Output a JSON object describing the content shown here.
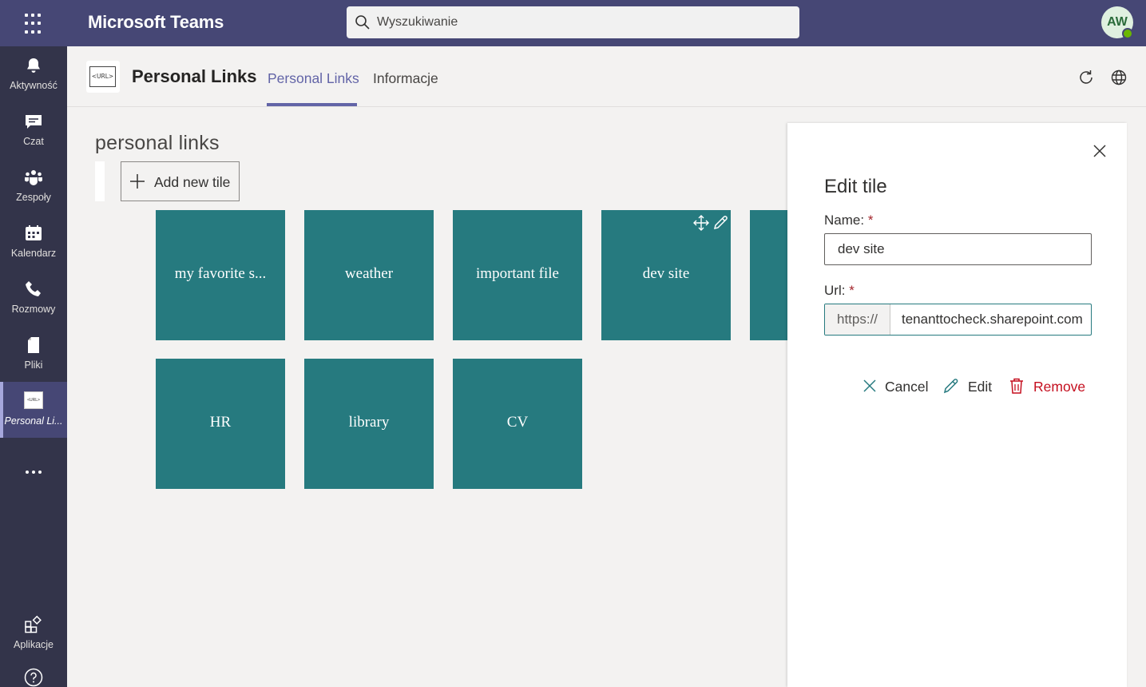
{
  "topbar": {
    "app_title": "Microsoft Teams",
    "search_placeholder": "Wyszukiwanie",
    "avatar_initials": "AW"
  },
  "rail": {
    "items": [
      {
        "label": "Aktywność",
        "icon": "bell-icon"
      },
      {
        "label": "Czat",
        "icon": "chat-icon"
      },
      {
        "label": "Zespoły",
        "icon": "teams-icon"
      },
      {
        "label": "Kalendarz",
        "icon": "calendar-icon"
      },
      {
        "label": "Rozmowy",
        "icon": "phone-icon"
      },
      {
        "label": "Pliki",
        "icon": "file-icon"
      },
      {
        "label": "Personal Li...",
        "icon": "personal-links-app-icon",
        "active": true
      }
    ],
    "apps_label": "Aplikacje"
  },
  "app_header": {
    "logo_text": "<URL>",
    "app_name": "Personal Links",
    "tabs": [
      {
        "label": "Personal Links",
        "active": true
      },
      {
        "label": "Informacje",
        "active": false
      }
    ]
  },
  "content": {
    "title": "personal links",
    "add_button_label": "Add new tile",
    "tiles": [
      {
        "label": "my favorite s..."
      },
      {
        "label": "weather"
      },
      {
        "label": "important file"
      },
      {
        "label": "dev site"
      },
      {
        "label": ""
      },
      {
        "label": "HR"
      },
      {
        "label": "library"
      },
      {
        "label": "CV"
      }
    ]
  },
  "edit_panel": {
    "title": "Edit tile",
    "name_label": "Name:",
    "name_value": "dev site",
    "url_label": "Url:",
    "url_prefix": "https://",
    "url_value": "tenanttocheck.sharepoint.com",
    "required_mark": "*",
    "cancel_label": "Cancel",
    "edit_label": "Edit",
    "remove_label": "Remove"
  },
  "colors": {
    "topbar": "#464775",
    "rail": "#33344a",
    "accent": "#6264a7",
    "tile": "#267a7f",
    "danger": "#c50f1f"
  }
}
